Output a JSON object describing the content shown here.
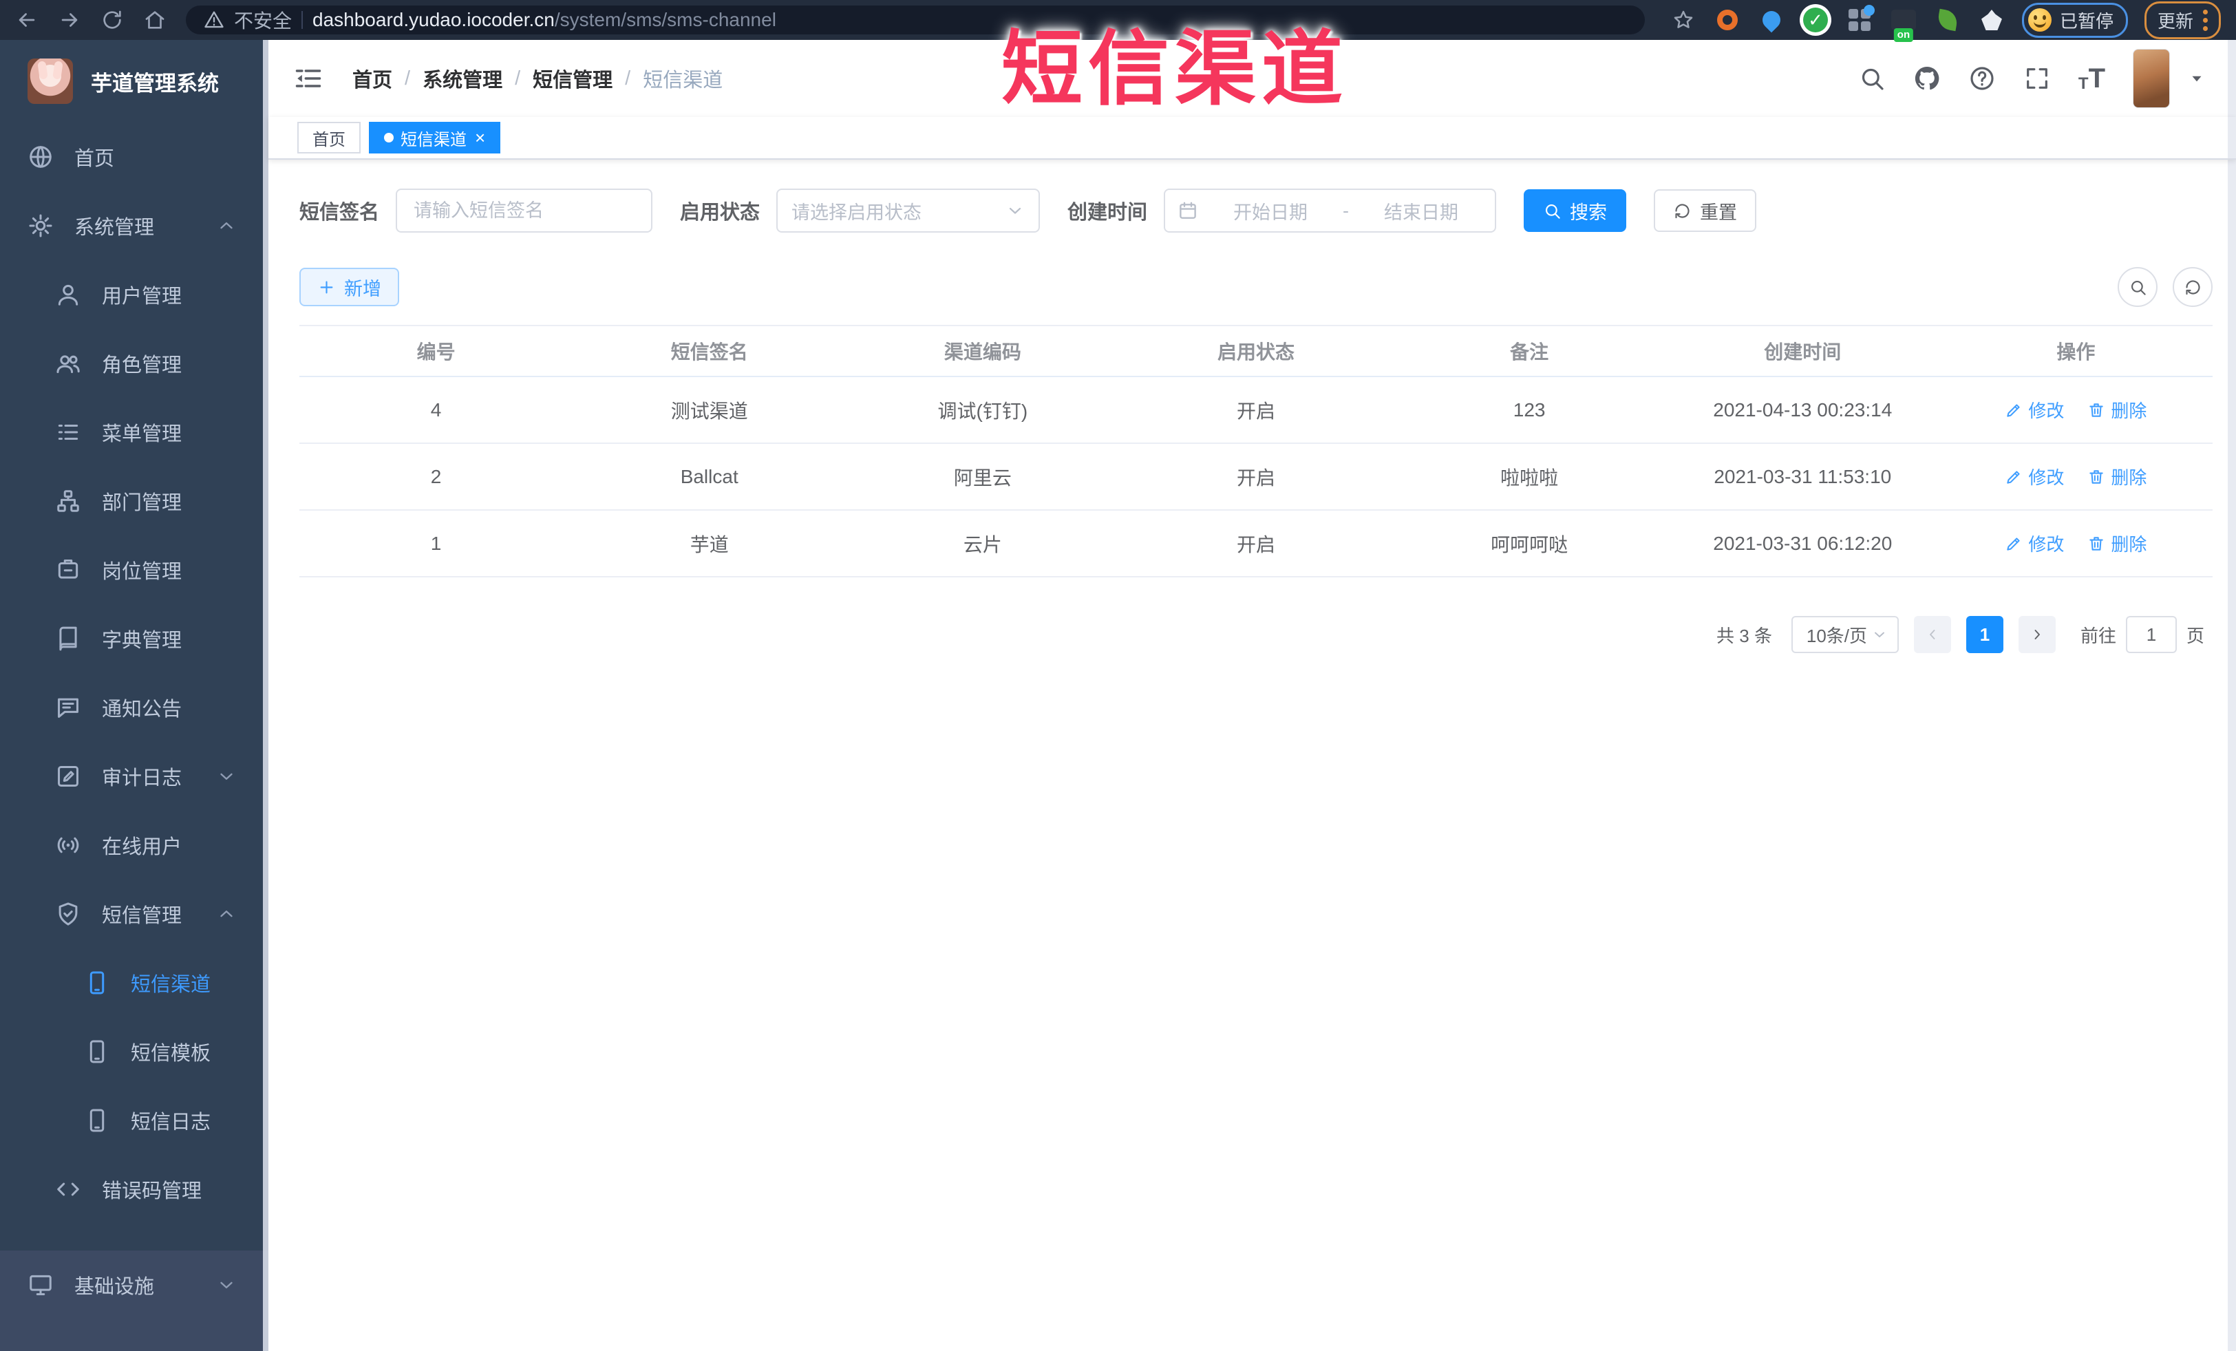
{
  "browser": {
    "security_label": "不安全",
    "url_host": "dashboard.yudao.iocoder.cn",
    "url_path": "/system/sms/sms-channel",
    "paused_badge": "已暂停",
    "update_label": "更新"
  },
  "overlay": {
    "title": "短信渠道",
    "color": "#f5365c"
  },
  "sidebar": {
    "app_title": "芋道管理系统",
    "items": [
      {
        "key": "home",
        "label": "首页",
        "icon": "home-icon",
        "level": 0
      },
      {
        "key": "system",
        "label": "系统管理",
        "icon": "gear-icon",
        "level": 0,
        "caret": "up"
      },
      {
        "key": "user",
        "label": "用户管理",
        "icon": "user-icon",
        "level": 1
      },
      {
        "key": "role",
        "label": "角色管理",
        "icon": "users-icon",
        "level": 1
      },
      {
        "key": "menu",
        "label": "菜单管理",
        "icon": "menu-list-icon",
        "level": 1
      },
      {
        "key": "dept",
        "label": "部门管理",
        "icon": "org-tree-icon",
        "level": 1
      },
      {
        "key": "post",
        "label": "岗位管理",
        "icon": "badge-icon",
        "level": 1
      },
      {
        "key": "dict",
        "label": "字典管理",
        "icon": "dictionary-icon",
        "level": 1
      },
      {
        "key": "notice",
        "label": "通知公告",
        "icon": "announcement-icon",
        "level": 1
      },
      {
        "key": "audit-log",
        "label": "审计日志",
        "icon": "audit-log-icon",
        "level": 1,
        "caret": "down"
      },
      {
        "key": "online-user",
        "label": "在线用户",
        "icon": "online-users-icon",
        "level": 1
      },
      {
        "key": "sms",
        "label": "短信管理",
        "icon": "sms-shield-icon",
        "level": 1,
        "caret": "up"
      },
      {
        "key": "sms-channel",
        "label": "短信渠道",
        "icon": "phone-icon",
        "level": 2,
        "active": true
      },
      {
        "key": "sms-template",
        "label": "短信模板",
        "icon": "phone-icon",
        "level": 2
      },
      {
        "key": "sms-log",
        "label": "短信日志",
        "icon": "phone-icon",
        "level": 2
      },
      {
        "key": "error-code",
        "label": "错误码管理",
        "icon": "code-icon",
        "level": 1
      },
      {
        "key": "infra",
        "label": "基础设施",
        "icon": "monitor-icon",
        "level": 0,
        "caret": "down",
        "section": "bottom"
      }
    ]
  },
  "header": {
    "breadcrumb": [
      "首页",
      "系统管理",
      "短信管理",
      "短信渠道"
    ],
    "separator": "/"
  },
  "tabs": [
    {
      "label": "首页",
      "active": false,
      "closable": false
    },
    {
      "label": "短信渠道",
      "active": true,
      "closable": true
    }
  ],
  "filters": {
    "sign_label": "短信签名",
    "sign_placeholder": "请输入短信签名",
    "status_label": "启用状态",
    "status_placeholder": "请选择启用状态",
    "time_label": "创建时间",
    "start_placeholder": "开始日期",
    "range_separator": "-",
    "end_placeholder": "结束日期",
    "search_label": "搜索",
    "reset_label": "重置"
  },
  "toolbar": {
    "add_label": "新增"
  },
  "table": {
    "headers": [
      "编号",
      "短信签名",
      "渠道编码",
      "启用状态",
      "备注",
      "创建时间",
      "操作"
    ],
    "rows": [
      {
        "id": "4",
        "sign": "测试渠道",
        "code": "调试(钉钉)",
        "status": "开启",
        "remark": "123",
        "created": "2021-04-13 00:23:14"
      },
      {
        "id": "2",
        "sign": "Ballcat",
        "code": "阿里云",
        "status": "开启",
        "remark": "啦啦啦",
        "created": "2021-03-31 11:53:10"
      },
      {
        "id": "1",
        "sign": "芋道",
        "code": "云片",
        "status": "开启",
        "remark": "呵呵呵哒",
        "created": "2021-03-31 06:12:20"
      }
    ],
    "edit_label": "修改",
    "delete_label": "删除"
  },
  "pagination": {
    "total": "共 3 条",
    "page_size": "10条/页",
    "current_page": "1",
    "goto_label": "前往",
    "goto_value": "1",
    "page_unit": "页"
  },
  "colors": {
    "accent": "#409eff",
    "tab_active": "#1890ff",
    "sidebar_bg": "#304156",
    "overlay_red": "#f5365c"
  }
}
